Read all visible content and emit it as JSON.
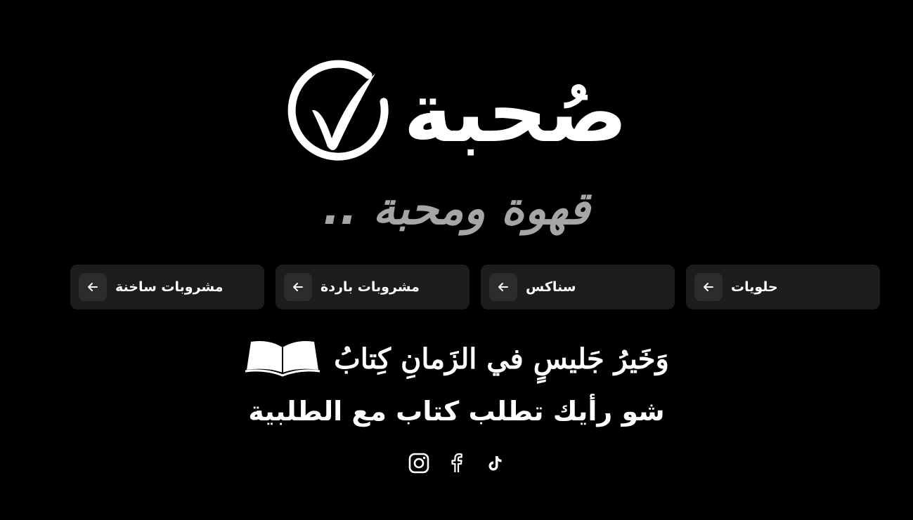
{
  "brand": {
    "logo_text": "صُحبة",
    "tagline": "قهوة ومحبة .."
  },
  "categories": [
    {
      "label": "حلويات",
      "icon": "arrow-left-icon"
    },
    {
      "label": "سناكس",
      "icon": "arrow-left-icon"
    },
    {
      "label": "مشروبات باردة",
      "icon": "arrow-left-icon"
    },
    {
      "label": "مشروبات ساخنة",
      "icon": "arrow-left-icon"
    }
  ],
  "quote": {
    "text": "وَخَيرُ جَليسٍ في الزَمانِ كِتابُ",
    "icon": "open-book-icon"
  },
  "subline": "شو رأيك تطلب كتاب مع الطلبية",
  "social": [
    {
      "name": "instagram",
      "icon": "instagram-icon"
    },
    {
      "name": "facebook",
      "icon": "facebook-icon"
    },
    {
      "name": "tiktok",
      "icon": "tiktok-icon"
    }
  ],
  "colors": {
    "background": "#000000",
    "card": "#1c1c1e",
    "arrow_box": "#2c2c2f",
    "tagline": "#a6a6a6",
    "text": "#ffffff"
  }
}
